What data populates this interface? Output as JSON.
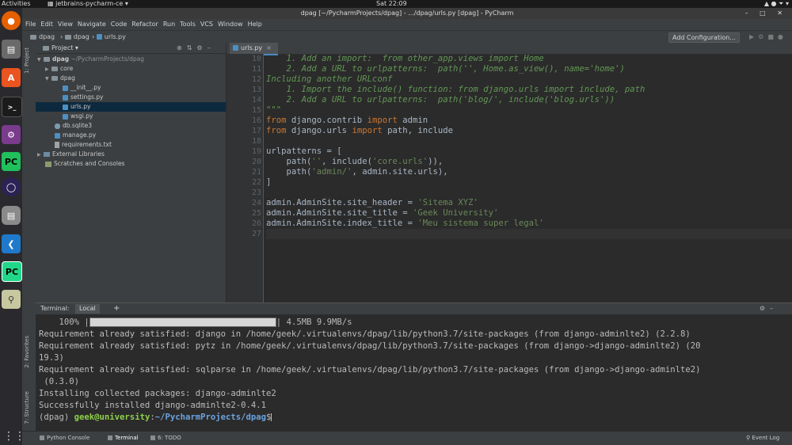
{
  "system": {
    "activities": "Activities",
    "app_name": "jetbrains-pycharm-ce",
    "clock": "Sat 22:09"
  },
  "window": {
    "title": "dpag [~/PycharmProjects/dpag] - .../dpag/urls.py [dpag] - PyCharm"
  },
  "menu": {
    "items": [
      "File",
      "Edit",
      "View",
      "Navigate",
      "Code",
      "Refactor",
      "Run",
      "Tools",
      "VCS",
      "Window",
      "Help"
    ]
  },
  "breadcrumb": {
    "items": [
      "dpag",
      "dpag",
      "urls.py"
    ]
  },
  "toolbar": {
    "add_configuration": "Add Configuration..."
  },
  "side_tabs": {
    "project": "1: Project",
    "favorites": "2: Favorites",
    "structure": "7: Structure"
  },
  "project_panel": {
    "title": "Project",
    "tree": [
      {
        "label": "dpag",
        "extra": "~/PycharmProjects/dpag",
        "kind": "folder",
        "expanded": true
      },
      {
        "label": "core",
        "kind": "folder",
        "expanded": false
      },
      {
        "label": "dpag",
        "kind": "folder",
        "expanded": true
      },
      {
        "label": "__init__.py",
        "kind": "py"
      },
      {
        "label": "settings.py",
        "kind": "py"
      },
      {
        "label": "urls.py",
        "kind": "py",
        "selected": true
      },
      {
        "label": "wsgi.py",
        "kind": "py"
      },
      {
        "label": "db.sqlite3",
        "kind": "db"
      },
      {
        "label": "manage.py",
        "kind": "py"
      },
      {
        "label": "requirements.txt",
        "kind": "txt"
      },
      {
        "label": "External Libraries",
        "kind": "lib",
        "expanded": false
      },
      {
        "label": "Scratches and Consoles",
        "kind": "scratch"
      }
    ]
  },
  "editor": {
    "tab": "urls.py",
    "lines": [
      {
        "n": "10",
        "text": "    1. Add an import:  from other_app.views import Home",
        "style": "doc"
      },
      {
        "n": "11",
        "text": "    2. Add a URL to urlpatterns:  path('', Home.as_view(), name='home')",
        "style": "doc"
      },
      {
        "n": "12",
        "text": "Including another URLconf",
        "style": "doc"
      },
      {
        "n": "13",
        "text": "    1. Import the include() function: from django.urls import include, path",
        "style": "doc"
      },
      {
        "n": "14",
        "text": "    2. Add a URL to urlpatterns:  path('blog/', include('blog.urls'))",
        "style": "doc"
      },
      {
        "n": "15",
        "text": "\"\"\"",
        "style": "doc"
      },
      {
        "n": "16",
        "text": "from django.contrib import admin",
        "style": "import"
      },
      {
        "n": "17",
        "text": "from django.urls import path, include",
        "style": "import"
      },
      {
        "n": "18",
        "text": "",
        "style": "plain"
      },
      {
        "n": "19",
        "text": "urlpatterns = [",
        "style": "plain"
      },
      {
        "n": "20",
        "text": "    path('', include('core.urls')),",
        "style": "plain"
      },
      {
        "n": "21",
        "text": "    path('admin/', admin.site.urls),",
        "style": "plain"
      },
      {
        "n": "22",
        "text": "]",
        "style": "plain"
      },
      {
        "n": "23",
        "text": "",
        "style": "plain"
      },
      {
        "n": "24",
        "text": "admin.AdminSite.site_header = 'Sitema XYZ'",
        "style": "plain"
      },
      {
        "n": "25",
        "text": "admin.AdminSite.site_title = 'Geek University'",
        "style": "plain"
      },
      {
        "n": "26",
        "text": "admin.AdminSite.index_title = 'Meu sistema super legal'",
        "style": "plain"
      },
      {
        "n": "27",
        "text": "",
        "style": "current"
      }
    ]
  },
  "terminal": {
    "label": "Terminal:",
    "tab": "Local",
    "add": "+",
    "progress": {
      "percent_text": "100%",
      "fraction": 1.0,
      "size_text": "4.5MB 9.9MB/s"
    },
    "lines": [
      "Requirement already satisfied: django in /home/geek/.virtualenvs/dpag/lib/python3.7/site-packages (from django-adminlte2) (2.2.8)",
      "Requirement already satisfied: pytz in /home/geek/.virtualenvs/dpag/lib/python3.7/site-packages (from django->django-adminlte2) (20",
      "19.3)",
      "Requirement already satisfied: sqlparse in /home/geek/.virtualenvs/dpag/lib/python3.7/site-packages (from django->django-adminlte2)",
      " (0.3.0)",
      "Installing collected packages: django-adminlte2",
      "Successfully installed django-adminlte2-0.4.1"
    ],
    "prompt": {
      "env": "(dpag) ",
      "user": "geek@university",
      "colon": ":",
      "path": "~/PycharmProjects/dpag",
      "symbol": "$"
    }
  },
  "bottom_tabs": {
    "python_console": "Python Console",
    "terminal": "Terminal",
    "todo": "6: TODO",
    "event_log": "Event Log"
  },
  "colors": {
    "keyword": "#cc7832",
    "string": "#6a8759",
    "docstring": "#629755",
    "prompt_user": "#8dd04a",
    "prompt_path": "#6ba3e0",
    "accent": "#4a88c7"
  }
}
